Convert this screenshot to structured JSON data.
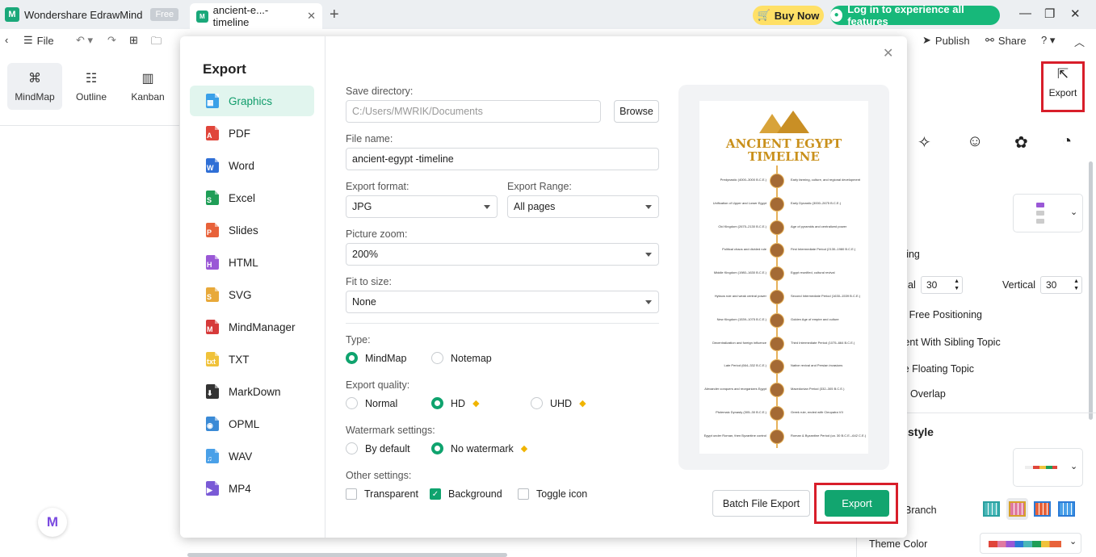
{
  "app": {
    "name": "Wondershare EdrawMind",
    "badge": "Free"
  },
  "doc_tab": {
    "title": "ancient-e...-timeline"
  },
  "header": {
    "buy_now": "Buy Now",
    "login": "Log in to experience all features",
    "publish": "Publish",
    "share": "Share"
  },
  "toolbar": {
    "file": "File"
  },
  "views": [
    {
      "label": "MindMap"
    },
    {
      "label": "Outline"
    },
    {
      "label": "Kanban"
    }
  ],
  "dialog": {
    "title": "Export",
    "formats": [
      {
        "label": "Graphics",
        "color": "#3aa0e8",
        "glyph": "▦"
      },
      {
        "label": "PDF",
        "color": "#e0453a",
        "glyph": "A"
      },
      {
        "label": "Word",
        "color": "#2f6fd6",
        "glyph": "W"
      },
      {
        "label": "Excel",
        "color": "#1f9e57",
        "glyph": "S"
      },
      {
        "label": "Slides",
        "color": "#e8623a",
        "glyph": "P"
      },
      {
        "label": "HTML",
        "color": "#9a58d6",
        "glyph": "H"
      },
      {
        "label": "SVG",
        "color": "#e8a93a",
        "glyph": "S"
      },
      {
        "label": "MindManager",
        "color": "#d63a3a",
        "glyph": "M"
      },
      {
        "label": "TXT",
        "color": "#f0c23a",
        "glyph": "txt"
      },
      {
        "label": "MarkDown",
        "color": "#333333",
        "glyph": "⬇"
      },
      {
        "label": "OPML",
        "color": "#3a8ad6",
        "glyph": "◉"
      },
      {
        "label": "WAV",
        "color": "#4aa0e8",
        "glyph": "♫"
      },
      {
        "label": "MP4",
        "color": "#7a5ad6",
        "glyph": "▶"
      }
    ],
    "save_directory": {
      "label": "Save directory:",
      "placeholder": "C:/Users/MWRIK/Documents",
      "browse": "Browse"
    },
    "file_name": {
      "label": "File name:",
      "value": "ancient-egypt -timeline"
    },
    "export_format": {
      "label": "Export format:",
      "value": "JPG"
    },
    "export_range": {
      "label": "Export Range:",
      "value": "All pages"
    },
    "picture_zoom": {
      "label": "Picture zoom:",
      "value": "200%"
    },
    "fit_to_size": {
      "label": "Fit to size:",
      "value": "None"
    },
    "type": {
      "label": "Type:",
      "options": [
        "MindMap",
        "Notemap"
      ],
      "selected": "MindMap"
    },
    "quality": {
      "label": "Export quality:",
      "options": [
        "Normal",
        "HD",
        "UHD"
      ],
      "selected": "HD"
    },
    "watermark": {
      "label": "Watermark settings:",
      "options": [
        "By default",
        "No watermark"
      ],
      "selected": "No watermark"
    },
    "other": {
      "label": "Other settings:",
      "transparent": "Transparent",
      "background": "Background",
      "toggle_icon": "Toggle icon",
      "background_checked": true
    },
    "batch_export": "Batch File Export",
    "export_button": "Export",
    "preview": {
      "title_line1": "ANCIENT EGYPT",
      "title_line2": "TIMELINE",
      "rows": [
        {
          "left": "Predynastic (4000–3000 B.C.E.)",
          "right": "Early farming, culture, and regional development"
        },
        {
          "left": "Unification of Upper and Lower Egypt",
          "right": "Early Dynastic (3000–2675 B.C.E.)"
        },
        {
          "left": "Old Kingdom (2675–2130 B.C.E.)",
          "right": "Age of pyramids and centralized power"
        },
        {
          "left": "Political chaos and divided rule",
          "right": "First Intermediate Period (2130–1980 B.C.E.)"
        },
        {
          "left": "Middle Kingdom (1980–1630 B.C.E.)",
          "right": "Egypt reunified, cultural revival"
        },
        {
          "left": "Hyksos rule and weak central power",
          "right": "Second Intermediate Period (1630–1539 B.C.E.)"
        },
        {
          "left": "New Kingdom (1539–1075 B.C.E.)",
          "right": "Golden Age of empire and culture"
        },
        {
          "left": "Decentralization and foreign influence",
          "right": "Third Intermediate Period (1075–664 B.C.E.)"
        },
        {
          "left": "Late Period (664–332 B.C.E.)",
          "right": "Native revival and Persian invasions"
        },
        {
          "left": "Alexander conquers and reorganizes Egypt",
          "right": "Macedonian Period (332–305 B.C.E.)"
        },
        {
          "left": "Ptolemaic Dynasty (305–30 B.C.E.)",
          "right": "Greek rule, ended with Cleopatra VII"
        },
        {
          "left": "Egypt under Roman, then Byzantine control",
          "right": "Roman & Byzantine Period (ca. 30 B.C.E.–642 C.E.)"
        }
      ]
    }
  },
  "right_panel": {
    "export_label": "Export",
    "spacing": "acing",
    "horizontal_partial": "al",
    "horizontal_value": "30",
    "vertical_label": "Vertical",
    "vertical_value": "30",
    "free_positioning": "ch Free Positioning",
    "sibling": "ment With Sibling Topic",
    "floating": "ble Floating Topic",
    "overlap": "Overlap",
    "style_heading": "style",
    "branch": "Branch",
    "theme_color": "Theme Color"
  }
}
